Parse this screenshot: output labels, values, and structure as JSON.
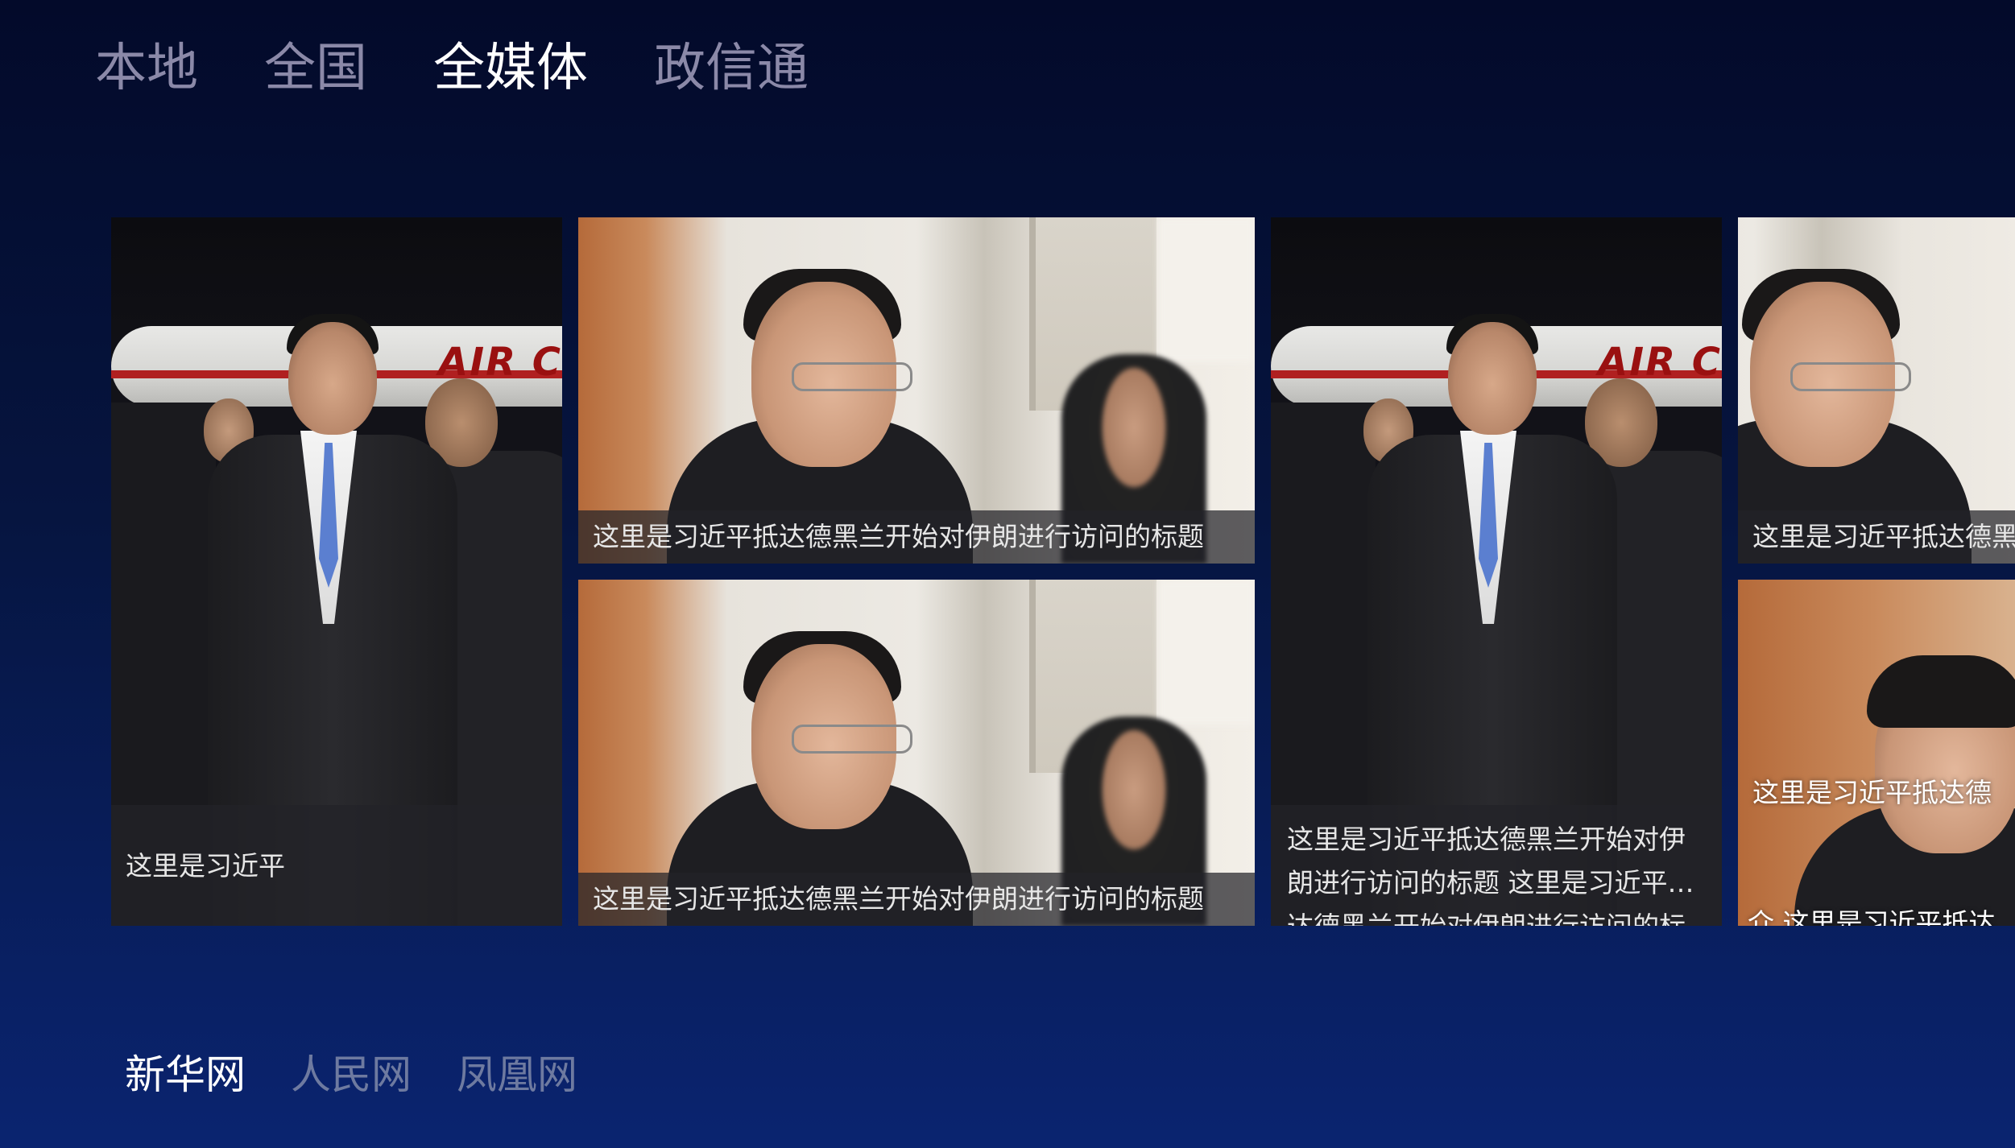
{
  "top_tabs": [
    {
      "label": "本地",
      "active": false
    },
    {
      "label": "全国",
      "active": false
    },
    {
      "label": "全媒体",
      "active": true
    },
    {
      "label": "政信通",
      "active": false
    }
  ],
  "cards": [
    {
      "photo": "airport-arrival-photo",
      "caption": "这里是习近平"
    },
    {
      "photo": "meeting-photo",
      "caption": "这里是习近平抵达德黑兰开始对伊朗进行访问的标题"
    },
    {
      "photo": "meeting-photo",
      "caption": "这里是习近平抵达德黑兰开始对伊朗进行访问的标题"
    },
    {
      "photo": "airport-arrival-photo",
      "caption": "这里是习近平抵达德黑兰开始对伊朗进行访问的标题 这里是习近平抵达德黑兰开始对伊朗进行访问的标题"
    },
    {
      "photo": "meeting-photo",
      "caption": "这里是习近平抵达德黑兰开始对伊朗进行访问的标题"
    },
    {
      "photo": "meeting-photo",
      "caption": "这里是习近平抵达德黑兰开始对伊朗进行访问的简介 这里是习近平抵达德黑兰开始对伊朗进行访问的简介",
      "caption_line1": "这里是习近平抵达德",
      "caption_line2": "介 这里是习近平抵达"
    }
  ],
  "plane_text": "AIR C",
  "bottom_tabs": [
    {
      "label": "新华网",
      "active": true
    },
    {
      "label": "人民网",
      "active": false
    },
    {
      "label": "凤凰网",
      "active": false
    }
  ],
  "colors": {
    "background_top": "#030a2a",
    "background_bottom": "#0a2470",
    "tab_active": "#ffffff",
    "tab_inactive": "#8b89a8"
  }
}
